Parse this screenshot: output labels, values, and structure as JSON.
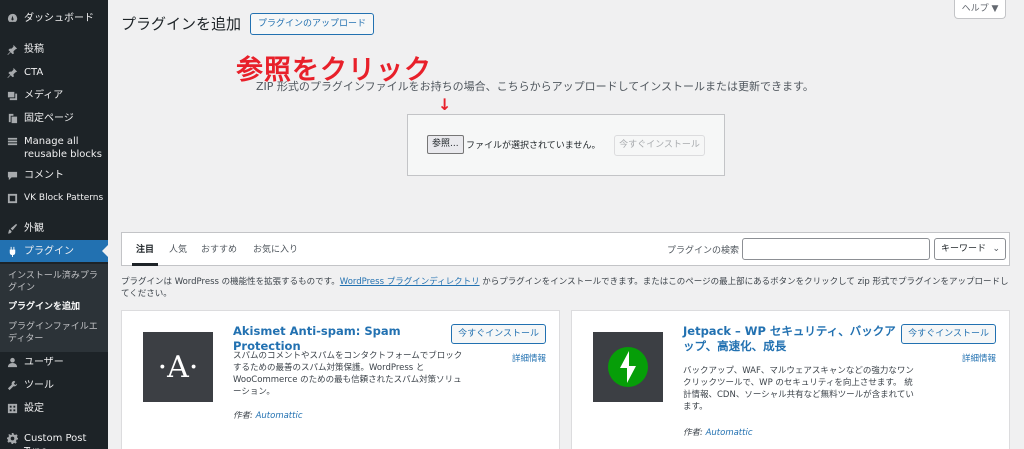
{
  "sidebar": {
    "items": [
      {
        "label": "ダッシュボード",
        "icon": "dashboard-icon"
      },
      {
        "label": "投稿",
        "icon": "pin-icon"
      },
      {
        "label": "CTA",
        "icon": "pin-icon"
      },
      {
        "label": "メディア",
        "icon": "media-icon"
      },
      {
        "label": "固定ページ",
        "icon": "page-icon"
      },
      {
        "label": "Manage all reusable blocks",
        "icon": "blocks-icon"
      },
      {
        "label": "コメント",
        "icon": "comment-icon"
      },
      {
        "label": "VK Block Patterns",
        "icon": "pattern-icon"
      },
      {
        "label": "外観",
        "icon": "brush-icon"
      },
      {
        "label": "プラグイン",
        "icon": "plugin-icon"
      },
      {
        "label": "ユーザー",
        "icon": "user-icon"
      },
      {
        "label": "ツール",
        "icon": "wrench-icon"
      },
      {
        "label": "設定",
        "icon": "settings-icon"
      },
      {
        "label": "Custom Post Type",
        "icon": "gear-icon"
      }
    ],
    "submenu": [
      {
        "label": "インストール済みプラグイン"
      },
      {
        "label": "プラグインを追加"
      },
      {
        "label": "プラグインファイルエディター"
      }
    ]
  },
  "header": {
    "title": "プラグインを追加",
    "upload_label": "プラグインのアップロード",
    "help_label": "ヘルプ ▼"
  },
  "upload": {
    "annotation": "参照をクリック",
    "instruction": "ZIP 形式のプラグインファイルをお持ちの場合、こちらからアップロードしてインストールまたは更新できます。",
    "arrow": "↓",
    "browse_label": "参照...",
    "file_status": "ファイルが選択されていません。",
    "install_label": "今すぐインストール"
  },
  "filter": {
    "tabs": [
      {
        "label": "注目"
      },
      {
        "label": "人気"
      },
      {
        "label": "おすすめ"
      },
      {
        "label": "お気に入り"
      }
    ],
    "search_label": "プラグインの検索",
    "search_value": "",
    "search_type": "キーワード"
  },
  "description": {
    "text1": "プラグインは WordPress の機能性を拡張するものです。",
    "link": "WordPress プラグインディレクトリ",
    "text2": " からプラグインをインストールできます。またはこのページの最上部にあるボタンをクリックして zip 形式でプラグインをアップロードしてください。"
  },
  "cards": [
    {
      "name": "Akismet Anti-spam: Spam Protection",
      "description": "スパムのコメントやスパムをコンタクトフォームでブロックするための最善のスパム対策保護。WordPress と WooCommerce のための最も信頼されたスパム対策ソリューション。",
      "install_label": "今すぐインストール",
      "more_label": "詳細情報",
      "author_prefix": "作者: ",
      "author": "Automattic",
      "icon_letter": "·A·",
      "icon_color": "#3c3f44"
    },
    {
      "name": "Jetpack – WP セキュリティ、バックアップ、高速化、成長",
      "description": "バックアップ、WAF、マルウェアスキャンなどの強力なワンクリックツールで、WP のセキュリティを向上させます。 統計情報、CDN、ソーシャル共有など無料ツールが含まれています。",
      "install_label": "今すぐインストール",
      "more_label": "詳細情報",
      "author_prefix": "作者: ",
      "author": "Automattic",
      "icon_color": "#069e08"
    }
  ],
  "colors": {
    "accent": "#2271b1",
    "sidebar_bg": "#1d2327",
    "annotation": "#e8202a"
  }
}
